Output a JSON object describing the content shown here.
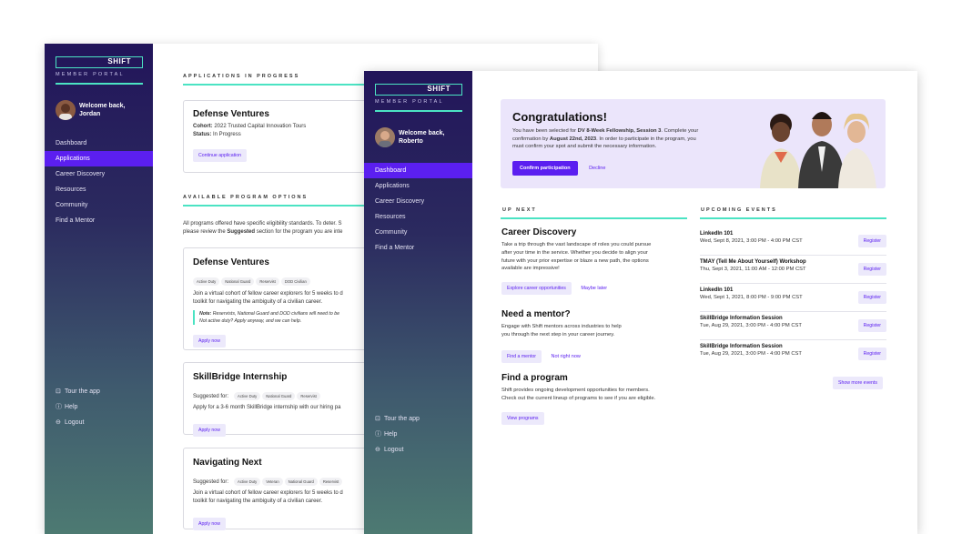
{
  "brand": {
    "logo": "SHIFT",
    "portal_label": "MEMBER PORTAL",
    "accent": "#4be3c3",
    "primary": "#5b1ff0"
  },
  "nav_items": [
    "Dashboard",
    "Applications",
    "Career Discovery",
    "Resources",
    "Community",
    "Find a Mentor"
  ],
  "footer_items": [
    {
      "icon": "map-icon",
      "label": "Tour the app"
    },
    {
      "icon": "help-icon",
      "label": "Help"
    },
    {
      "icon": "logout-icon",
      "label": "Logout"
    }
  ],
  "window_back": {
    "welcome": "Welcome back,",
    "user": "Jordan",
    "active_nav": "Applications",
    "applications_title": "APPLICATIONS IN PROGRESS",
    "app_card": {
      "title": "Defense Ventures",
      "cohort_label": "Cohort:",
      "cohort_value": "2022 Trusted Capital Innovation Tours",
      "status_label": "Status:",
      "status_value": "In Progress",
      "button": "Continue application"
    },
    "programs_title": "AVAILABLE PROGRAM OPTIONS",
    "programs_intro_1": "All programs offered have specific eligibility standards. To deter. S",
    "programs_intro_2a": "please review the ",
    "programs_intro_bold": "Suggested",
    "programs_intro_2b": " section for the program you are inte",
    "programs": [
      {
        "title": "Defense Ventures",
        "tags": [
          "Active Duty",
          "National Guard",
          "Reservist",
          "DOD Civilian"
        ],
        "desc_1": "Join a virtual cohort of fellow career explorers for 5 weeks to d",
        "desc_2": "toolkit for navigating the ambiguity of a civilian career.",
        "note_bold": "Note:",
        "note_1": " Reservists, National Guard and DOD civilians will need to be",
        "note_2": "Not active duty? Apply anyway, and we can help.",
        "button": "Apply now"
      },
      {
        "title": "SkillBridge Internship",
        "suggested": "Suggested for:",
        "tags": [
          "Active Duty",
          "National Guard",
          "Reservist"
        ],
        "desc_1": "Apply for a 3-6 month SkillBridge internship with our hiring pa",
        "button": "Apply now"
      },
      {
        "title": "Navigating Next",
        "suggested": "Suggested for:",
        "tags": [
          "Active Duty",
          "Veteran",
          "National Guard",
          "Reservist"
        ],
        "desc_1": "Join a virtual cohort of fellow career explorers for 5 weeks to d",
        "desc_2": "toolkit for navigating the ambiguity of a civilian career.",
        "button": "Apply now"
      }
    ]
  },
  "window_front": {
    "welcome": "Welcome back,",
    "user": "Roberto",
    "active_nav": "Dashboard",
    "banner": {
      "title": "Congratulations!",
      "line1_a": "You have been selected for ",
      "line1_b": "DV 8-Week Fellowship, Session 3",
      "line1_c": ". Complete your",
      "line2_a": "confirmation by ",
      "line2_b": "August 22nd, 2023",
      "line2_c": ". In order to participate in the program, you",
      "line3": "must confirm your spot and submit the necessary information.",
      "confirm": "Confirm participation",
      "decline": "Decline"
    },
    "up_next_title": "UP NEXT",
    "career": {
      "title": "Career Discovery",
      "lines": [
        "Take a trip through the vast landscape of roles you could pursue",
        "after your time in the service. Whether you decide to align your",
        "future with your prior expertise or blaze a new path, the options",
        "available are impressive!"
      ],
      "button": "Explore career opportunities",
      "link": "Maybe later"
    },
    "mentor": {
      "title": "Need a mentor?",
      "lines": [
        "Engage with Shift mentors across industries to help",
        "you through the next step in your career journey."
      ],
      "button": "Find a mentor",
      "link": "Not right now"
    },
    "program": {
      "title": "Find a program",
      "lines": [
        "Shift provides ongoing development opportunities for members.",
        "Check out the current lineup of programs to see if you are eligible."
      ],
      "button": "View programs"
    },
    "events_title": "UPCOMING EVENTS",
    "events": [
      {
        "title": "LinkedIn 101",
        "date": "Wed, Sept 8, 2021, 3:00 PM - 4:00 PM CST"
      },
      {
        "title": "TMAY (Tell Me About Yourself) Workshop",
        "date": "Thu, Sept 3, 2021, 11:00 AM - 12:00 PM CST"
      },
      {
        "title": "LinkedIn 101",
        "date": "Wed, Sept 1, 2021, 8:00 PM - 9:00 PM CST"
      },
      {
        "title": "SkillBridge Information Session",
        "date": "Tue, Aug 29, 2021, 3:00 PM - 4:00 PM CST"
      },
      {
        "title": "SkillBridge Information Session",
        "date": "Tue, Aug 29, 2021, 3:00 PM - 4:00 PM CST"
      }
    ],
    "register_label": "Register",
    "more_events": "Show more events"
  }
}
